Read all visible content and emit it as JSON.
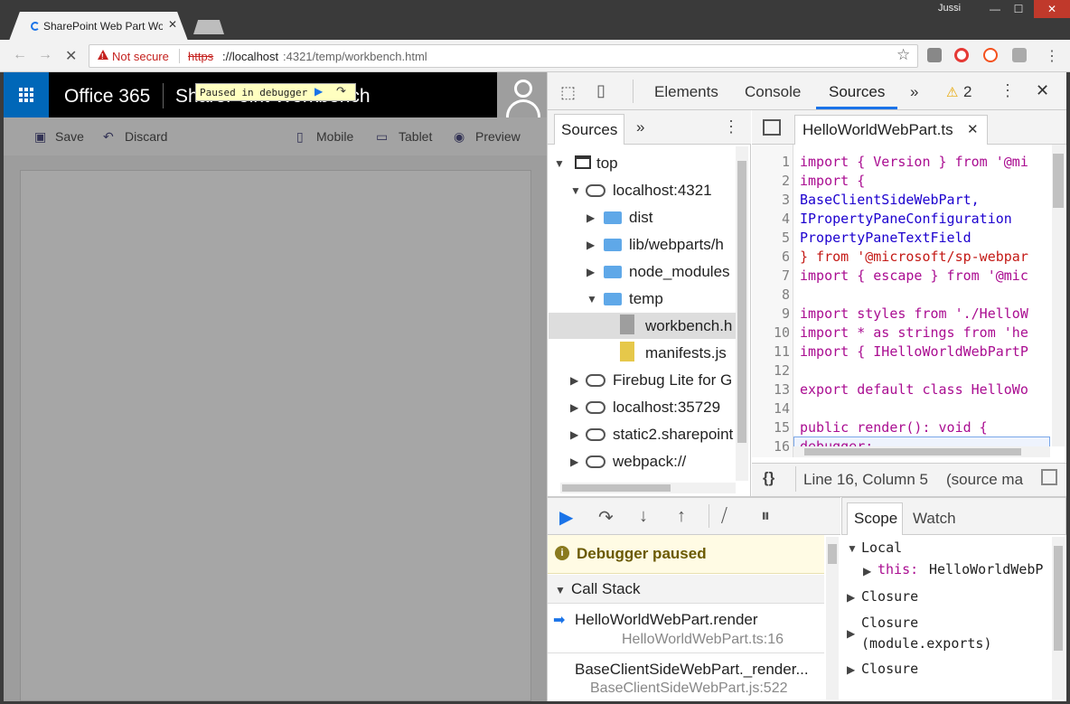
{
  "browser": {
    "tab_title": "SharePoint Web Part Wo",
    "user": "Jussi",
    "not_secure": "Not secure",
    "url_scheme": "https",
    "url_host": "://localhost",
    "url_path": ":4321/temp/workbench.html"
  },
  "workbench": {
    "app_name": "Office 365",
    "title": "SharePoint Workbench",
    "paused_overlay": "Paused in debugger",
    "commands": {
      "save": "Save",
      "discard": "Discard",
      "mobile": "Mobile",
      "tablet": "Tablet",
      "preview": "Preview"
    }
  },
  "devtools": {
    "tabs": {
      "elements": "Elements",
      "console": "Console",
      "sources": "Sources",
      "more": "»",
      "warnings": "2"
    },
    "navigator": {
      "tab": "Sources",
      "more": "»",
      "tree": [
        "top",
        "localhost:4321",
        "dist",
        "lib/webparts/h",
        "node_modules",
        "temp",
        "workbench.h",
        "manifests.js",
        "Firebug Lite for G",
        "localhost:35729",
        "static2.sharepoint",
        "webpack://"
      ]
    },
    "editor": {
      "file": "HelloWorldWebPart.ts",
      "line_numbers": [
        "1",
        "2",
        "3",
        "4",
        "5",
        "6",
        "7",
        "8",
        "9",
        "10",
        "11",
        "12",
        "13",
        "14",
        "15",
        "16"
      ],
      "lines": [
        "import { Version } from '@mi",
        "import {",
        "  BaseClientSideWebPart,",
        "  IPropertyPaneConfiguration",
        "  PropertyPaneTextField",
        "} from '@microsoft/sp-webpar",
        "import { escape } from '@mic",
        "",
        "import styles from './HelloW",
        "import * as strings from 'he",
        "import { IHelloWorldWebPartP",
        "",
        "export default class HelloWo",
        "",
        "  public render(): void {",
        "    debugger;"
      ],
      "status": "Line 16, Column 5",
      "status_extra": "(source ma",
      "pretty": "{}"
    },
    "debugger": {
      "paused": "Debugger paused",
      "callstack_title": "Call Stack",
      "frames": [
        {
          "fn": "HelloWorldWebPart.render",
          "loc": "HelloWorldWebPart.ts:16"
        },
        {
          "fn": "BaseClientSideWebPart._render...",
          "loc": "BaseClientSideWebPart.js:522"
        }
      ]
    },
    "scope": {
      "tabs": {
        "scope": "Scope",
        "watch": "Watch"
      },
      "local": "Local",
      "this_key": "this:",
      "this_val": "HelloWorldWebP",
      "closure1": "Closure",
      "closure2": "Closure",
      "closure2b": "(module.exports)",
      "closure3": "Closure"
    }
  },
  "colors": {
    "accent": "#1a73e8",
    "o365_blue": "#0067b8",
    "warning": "#e8a600"
  }
}
